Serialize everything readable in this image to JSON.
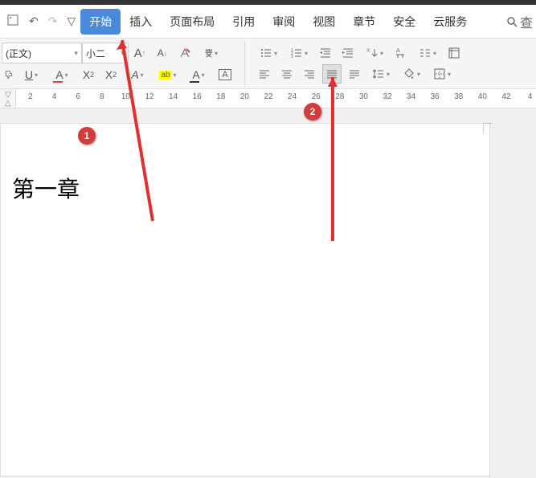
{
  "top_bar": {},
  "menu": {
    "tabs": [
      "开始",
      "插入",
      "页面布局",
      "引用",
      "审阅",
      "视图",
      "章节",
      "安全",
      "云服务"
    ],
    "search_text": "查"
  },
  "font": {
    "name": "(正文)",
    "size": "小二"
  },
  "toolbar_row1": {
    "grow_font": "A",
    "shrink_font": "A",
    "clear_format": "◇",
    "phonetic": "변"
  },
  "toolbar_row2": {
    "underline": "U",
    "font_color": "A",
    "superscript_x": "X",
    "subscript_x": "X",
    "style_a": "A",
    "highlight": "ab",
    "text_color": "A",
    "case_a": "A"
  },
  "para_row1": {
    "align_style": "A"
  },
  "ruler": {
    "numbers": [
      2,
      4,
      6,
      8,
      10,
      12,
      14,
      16,
      18,
      20,
      22,
      24,
      26,
      28,
      30,
      32,
      34,
      36,
      38,
      40,
      42,
      "4"
    ]
  },
  "doc": {
    "heading": "第一章"
  },
  "badges": {
    "b1": "1",
    "b2": "2"
  }
}
